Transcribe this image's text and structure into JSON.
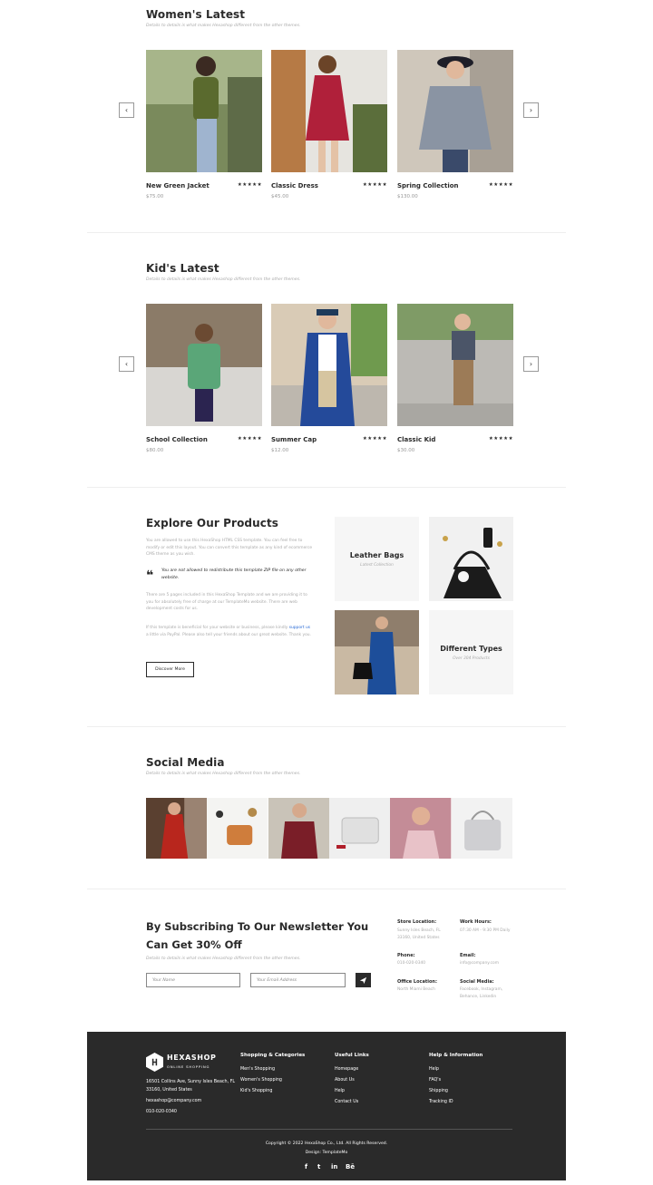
{
  "women": {
    "title": "Women's Latest",
    "subtitle": "Details to details is what makes Hexashop different from the other themes.",
    "prev_icon": "chevron-left-icon",
    "next_icon": "chevron-right-icon",
    "products": [
      {
        "name": "New Green Jacket",
        "price": "$75.00",
        "stars": "★★★★★"
      },
      {
        "name": "Classic Dress",
        "price": "$45.00",
        "stars": "★★★★★"
      },
      {
        "name": "Spring Collection",
        "price": "$130.00",
        "stars": "★★★★★"
      }
    ]
  },
  "kids": {
    "title": "Kid's Latest",
    "subtitle": "Details to details is what makes Hexashop different from the other themes.",
    "products": [
      {
        "name": "School Collection",
        "price": "$80.00",
        "stars": "★★★★★"
      },
      {
        "name": "Summer Cap",
        "price": "$12.00",
        "stars": "★★★★★"
      },
      {
        "name": "Classic Kid",
        "price": "$30.00",
        "stars": "★★★★★"
      }
    ]
  },
  "explore": {
    "title": "Explore Our Products",
    "para1": "You are allowed to use this HexaShop HTML CSS template. You can feel free to modify or edit this layout. You can convert this template as any kind of ecommerce CMS theme as you wish.",
    "quote": "You are not allowed to redistribute this template ZIP file on any other website.",
    "para2": "There are 5 pages included in this HexaShop Template and we are providing it to you for absolutely free of charge at our TemplateMo website. There are web development costs for us.",
    "para3_start": "If this template is beneficial for your website or business, please kindly",
    "para3_link": "support us",
    "para3_end": "a little via PayPal. Please also tell your friends about our great website. Thank you.",
    "button": "Discover More",
    "tile1_title": "Leather Bags",
    "tile1_sub": "Latest Collection",
    "tile2_title": "Different Types",
    "tile2_sub": "Over 304 Products"
  },
  "social": {
    "title": "Social Media",
    "subtitle": "Details to details is what makes Hexashop different from the other themes."
  },
  "newsletter": {
    "title": "By Subscribing To Our Newsletter You Can Get 30% Off",
    "subtitle": "Details to details is what makes Hexashop different from the other themes.",
    "name_placeholder": "Your Name",
    "email_placeholder": "Your Email Address",
    "send_icon": "paper-plane-icon",
    "store_label": "Store Location:",
    "store_value": "Sunny Isles Beach, FL 33160, United States",
    "hours_label": "Work Hours:",
    "hours_value": "07:30 AM - 9:30 PM Daily",
    "phone_label": "Phone:",
    "phone_value": "010-020-0340",
    "email_label": "Email:",
    "email_value": "info@company.com",
    "office_label": "Office Location:",
    "office_value": "North Miami Beach",
    "social_label": "Social Media:",
    "social_value": "Facebook, Instagram, Behance, Linkedin"
  },
  "footer": {
    "logo_name": "HEXASHOP",
    "logo_sub": "ONLINE SHOPPING",
    "address": "16501 Collins Ave, Sunny Isles Beach, FL 33160, United States",
    "email": "hexashop@company.com",
    "phone": "010-020-0340",
    "col1_title": "Shopping & Categories",
    "col1_items": [
      "Men's Shopping",
      "Women's Shopping",
      "Kid's Shopping"
    ],
    "col2_title": "Useful Links",
    "col2_items": [
      "Homepage",
      "About Us",
      "Help",
      "Contact Us"
    ],
    "col3_title": "Help & Information",
    "col3_items": [
      "Help",
      "FAQ's",
      "Shipping",
      "Tracking ID"
    ],
    "copyright": "Copyright © 2022 HexaShop Co., Ltd. All Rights Reserved.",
    "design": "Design: TemplateMo",
    "social_icons": [
      "f",
      "t",
      "in",
      "Bē"
    ]
  },
  "colors": {
    "dark": "#2a2a2a",
    "muted": "#aaaaaa",
    "tile_bg": "#f6f6f6",
    "link": "#2a6bd6"
  }
}
